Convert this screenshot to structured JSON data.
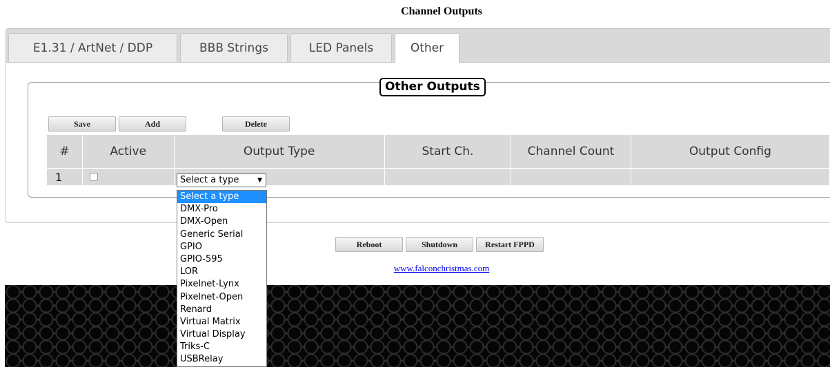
{
  "page": {
    "title": "Channel Outputs"
  },
  "tabs": [
    {
      "label": "E1.31 / ArtNet / DDP",
      "active": false
    },
    {
      "label": "BBB Strings",
      "active": false
    },
    {
      "label": "LED Panels",
      "active": false
    },
    {
      "label": "Other",
      "active": true
    }
  ],
  "section": {
    "legend": "Other Outputs"
  },
  "toolbar": {
    "save": "Save",
    "add": "Add",
    "delete": "Delete"
  },
  "table": {
    "headers": [
      "#",
      "Active",
      "Output Type",
      "Start Ch.",
      "Channel Count",
      "Output Config"
    ],
    "rows": [
      {
        "num": "1",
        "active": false,
        "output_type": "Select a type"
      }
    ]
  },
  "dropdown": {
    "selected": "Select a type",
    "options": [
      "Select a type",
      "DMX-Pro",
      "DMX-Open",
      "Generic Serial",
      "GPIO",
      "GPIO-595",
      "LOR",
      "Pixelnet-Lynx",
      "Pixelnet-Open",
      "Renard",
      "Virtual Matrix",
      "Virtual Display",
      "Triks-C",
      "USBRelay"
    ]
  },
  "system_buttons": {
    "reboot": "Reboot",
    "shutdown": "Shutdown",
    "restart": "Restart FPPD"
  },
  "footer": {
    "link": "www.falconchristmas.com"
  },
  "colors": {
    "tab_bg": "#d9d9d9",
    "table_bg": "#d9d9d9",
    "selected_option": "#1e90ff",
    "link": "#0000ee"
  },
  "icons": {
    "select_arrow": "chevron-down-icon"
  }
}
